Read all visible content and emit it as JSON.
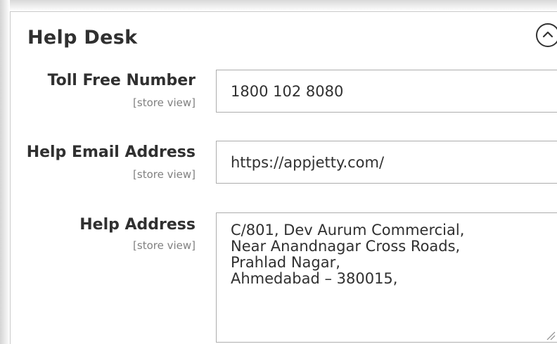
{
  "section": {
    "title": "Help Desk",
    "collapse_icon": "chevron-up-circle-icon"
  },
  "fields": {
    "toll_free": {
      "label": "Toll Free Number",
      "scope": "[store view]",
      "value": "1800 102 8080"
    },
    "help_email": {
      "label": "Help Email Address",
      "scope": "[store view]",
      "value": "https://appjetty.com/"
    },
    "help_address": {
      "label": "Help Address",
      "scope": "[store view]",
      "lines": [
        "C/801, Dev Aurum Commercial,",
        "Near Anandnagar Cross Roads,",
        "Prahlad Nagar,",
        "Ahmedabad – 380015,"
      ]
    }
  },
  "colors": {
    "text": "#303030",
    "scope_text": "#808080",
    "border": "#adadad"
  }
}
